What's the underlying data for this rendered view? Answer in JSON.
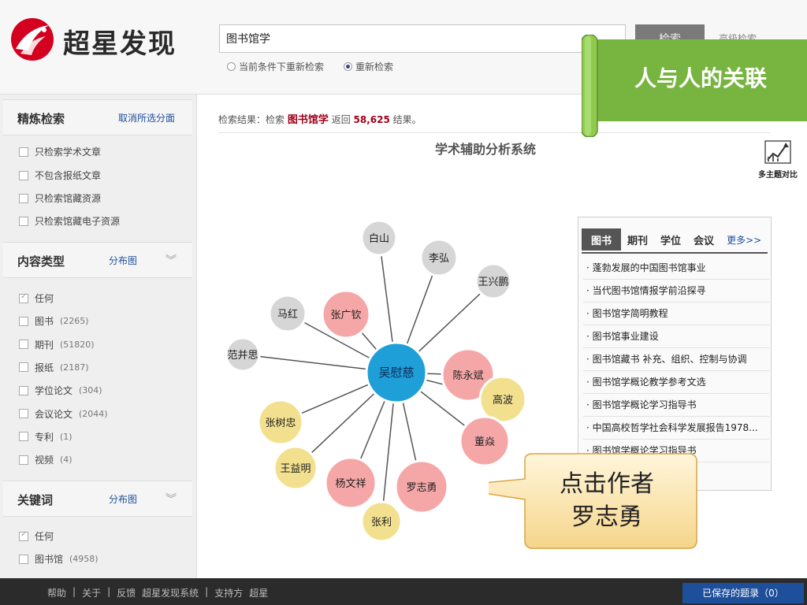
{
  "brand": {
    "name": "超星发现",
    "accent": "#d3001f"
  },
  "search": {
    "value": "图书馆学",
    "button": "检索",
    "advanced": "高级检索"
  },
  "search_options": [
    {
      "label": "当前条件下重新检索",
      "selected": false
    },
    {
      "label": "重新检索",
      "selected": true
    }
  ],
  "refine": {
    "title": "精炼检索",
    "cancel": "取消所选分面",
    "options": [
      "只检索学术文章",
      "不包含报纸文章",
      "只检索馆藏资源",
      "只检索馆藏电子资源"
    ]
  },
  "content_type": {
    "title": "内容类型",
    "chart_link": "分布图",
    "options": [
      {
        "label": "任何",
        "count": "",
        "checked": true
      },
      {
        "label": "图书",
        "count": "(2265)",
        "checked": false
      },
      {
        "label": "期刊",
        "count": "(51820)",
        "checked": false
      },
      {
        "label": "报纸",
        "count": "(2187)",
        "checked": false
      },
      {
        "label": "学位论文",
        "count": "(304)",
        "checked": false
      },
      {
        "label": "会议论文",
        "count": "(2044)",
        "checked": false
      },
      {
        "label": "专利",
        "count": "(1)",
        "checked": false
      },
      {
        "label": "视频",
        "count": "(4)",
        "checked": false
      }
    ]
  },
  "keywords": {
    "title": "关键词",
    "chart_link": "分布图",
    "options": [
      {
        "label": "任何",
        "count": "",
        "checked": true
      },
      {
        "label": "图书馆",
        "count": "(4958)",
        "checked": false
      }
    ]
  },
  "results": {
    "prefix": "检索结果：检索",
    "keyword": "图书馆学",
    "middle": "返回",
    "count": "58,625",
    "suffix": "结果。"
  },
  "system_title": "学术辅助分析系统",
  "multi_compare": "多主题对比",
  "graph": {
    "center": "吴慰慈",
    "nodes": [
      {
        "name": "白山",
        "tone": "gray"
      },
      {
        "name": "李弘",
        "tone": "gray"
      },
      {
        "name": "王兴鹏",
        "tone": "gray"
      },
      {
        "name": "马红",
        "tone": "gray"
      },
      {
        "name": "张广钦",
        "tone": "pink"
      },
      {
        "name": "范并思",
        "tone": "gray"
      },
      {
        "name": "陈永斌",
        "tone": "pink"
      },
      {
        "name": "高波",
        "tone": "yellow"
      },
      {
        "name": "张树忠",
        "tone": "yellow"
      },
      {
        "name": "董焱",
        "tone": "pink"
      },
      {
        "name": "王益明",
        "tone": "yellow"
      },
      {
        "name": "杨文祥",
        "tone": "pink"
      },
      {
        "name": "罗志勇",
        "tone": "pink"
      },
      {
        "name": "张利",
        "tone": "yellow"
      }
    ],
    "colors": {
      "center": "#1e9fd8",
      "pink": "#f5a7a7",
      "yellow": "#f3e08f",
      "gray": "#d6d6d6"
    }
  },
  "book_tabs": [
    {
      "label": "图书",
      "active": true
    },
    {
      "label": "期刊",
      "active": false
    },
    {
      "label": "学位",
      "active": false
    },
    {
      "label": "会议",
      "active": false
    },
    {
      "label": "更多>>",
      "active": false
    }
  ],
  "books": [
    "蓬勃发展的中国图书馆事业",
    "当代图书馆情报学前沿探寻",
    "图书馆学简明教程",
    "图书馆事业建设",
    "图书馆藏书 补充、组织、控制与协调",
    "图书馆学概论教学参考文选",
    "图书馆学概论学习指导书",
    "中国高校哲学社会科学发展报告1978...",
    "图书馆学概论学习指导书"
  ],
  "footer": {
    "links": [
      "帮助",
      "|",
      "关于",
      "|",
      "反馈",
      "超星发现系统",
      "|",
      "支持方",
      "超星"
    ],
    "saved": "已保存的题录（0）"
  },
  "overlay": {
    "banner": "人与人的关联",
    "callout_line1": "点击作者",
    "callout_line2": "罗志勇"
  }
}
